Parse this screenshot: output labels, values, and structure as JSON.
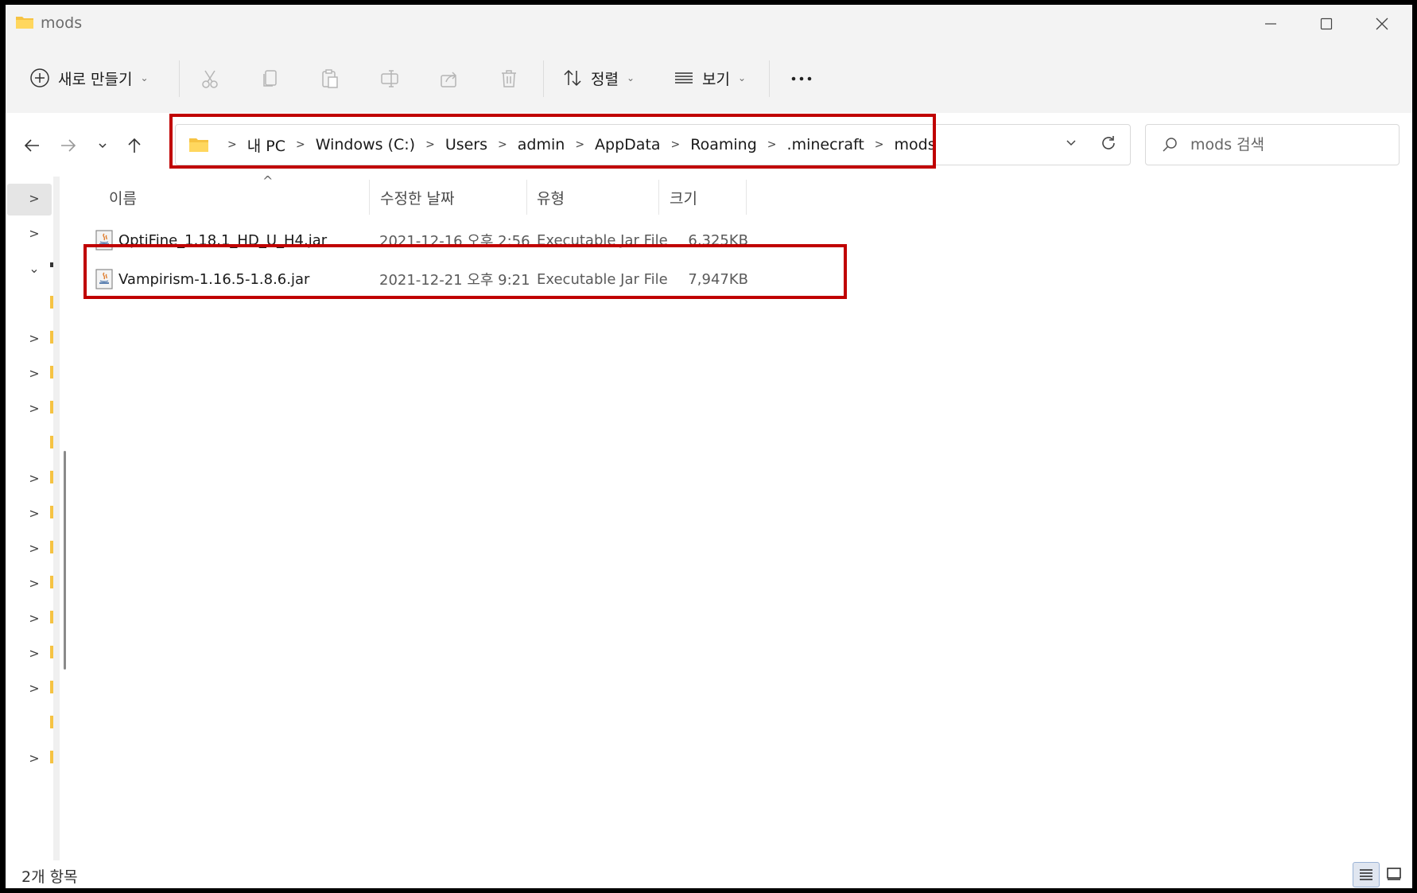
{
  "window": {
    "title": "mods",
    "minimize_icon": "minimize-icon",
    "maximize_icon": "maximize-icon",
    "close_icon": "close-icon"
  },
  "toolbar": {
    "new_label": "새로 만들기",
    "sort_label": "정렬",
    "view_label": "보기",
    "more_icon": "more-icon",
    "icons": [
      "cut-icon",
      "copy-icon",
      "paste-icon",
      "rename-icon",
      "share-icon",
      "delete-icon"
    ]
  },
  "address": {
    "crumbs": [
      "내 PC",
      "Windows (C:)",
      "Users",
      "admin",
      "AppData",
      "Roaming",
      ".minecraft",
      "mods"
    ]
  },
  "search": {
    "placeholder": "mods 검색"
  },
  "columns": {
    "name": "이름",
    "date": "수정한 날짜",
    "type": "유형",
    "size": "크기"
  },
  "files": [
    {
      "name": "OptiFine_1.18.1_HD_U_H4.jar",
      "date": "2021-12-16 오후 2:56",
      "type": "Executable Jar File",
      "size": "6,325KB"
    },
    {
      "name": "Vampirism-1.16.5-1.8.6.jar",
      "date": "2021-12-21 오후 9:21",
      "type": "Executable Jar File",
      "size": "7,947KB"
    }
  ],
  "status": {
    "count": "2개 항목"
  },
  "colors": {
    "highlight": "#c00000",
    "folder": "#f6c342"
  }
}
